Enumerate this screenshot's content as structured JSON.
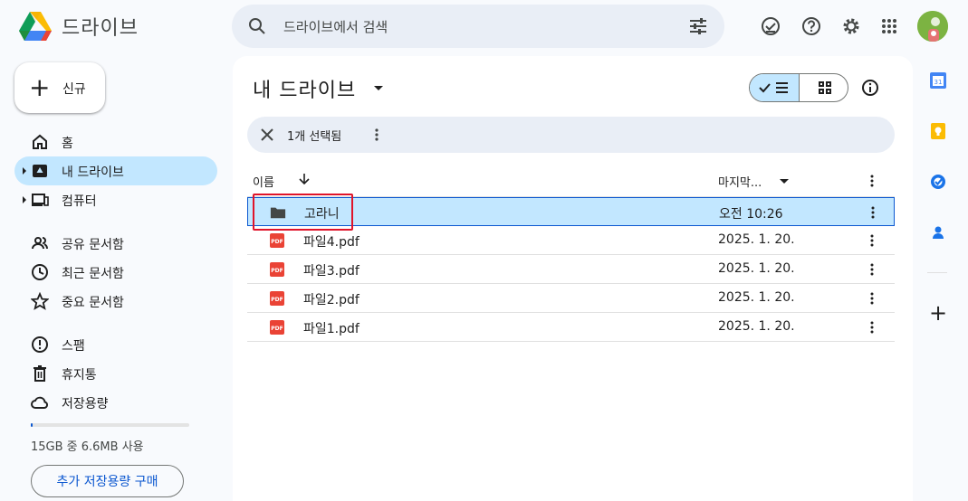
{
  "app": {
    "title": "드라이브"
  },
  "search": {
    "placeholder": "드라이브에서 검색"
  },
  "sidebar": {
    "new_label": "신규",
    "items": [
      {
        "label": "홈",
        "icon": "home-icon"
      },
      {
        "label": "내 드라이브",
        "icon": "my-drive-icon",
        "active": true
      },
      {
        "label": "컴퓨터",
        "icon": "computer-icon"
      },
      {
        "label": "공유 문서함",
        "icon": "shared-icon"
      },
      {
        "label": "최근 문서함",
        "icon": "recent-icon"
      },
      {
        "label": "중요 문서함",
        "icon": "star-icon"
      },
      {
        "label": "스팸",
        "icon": "spam-icon"
      },
      {
        "label": "휴지통",
        "icon": "trash-icon"
      },
      {
        "label": "저장용량",
        "icon": "cloud-icon"
      }
    ],
    "storage_text": "15GB 중 6.6MB 사용",
    "storage_fraction": 0.0004,
    "buy_label": "추가 저장용량 구매"
  },
  "main": {
    "title": "내 드라이브",
    "selection_text": "1개 선택됨",
    "columns": {
      "name": "이름",
      "modified": "마지막..."
    },
    "files": [
      {
        "name": "고라니",
        "type": "folder",
        "modified": "오전 10:26",
        "selected": true
      },
      {
        "name": "파일4.pdf",
        "type": "pdf",
        "modified": "2025. 1. 20."
      },
      {
        "name": "파일3.pdf",
        "type": "pdf",
        "modified": "2025. 1. 20."
      },
      {
        "name": "파일2.pdf",
        "type": "pdf",
        "modified": "2025. 1. 20."
      },
      {
        "name": "파일1.pdf",
        "type": "pdf",
        "modified": "2025. 1. 20."
      }
    ]
  },
  "colors": {
    "accent": "#0b57d0",
    "selected_bg": "#c2e7ff",
    "highlight": "#e0142a",
    "pdf_red": "#ea4335"
  }
}
